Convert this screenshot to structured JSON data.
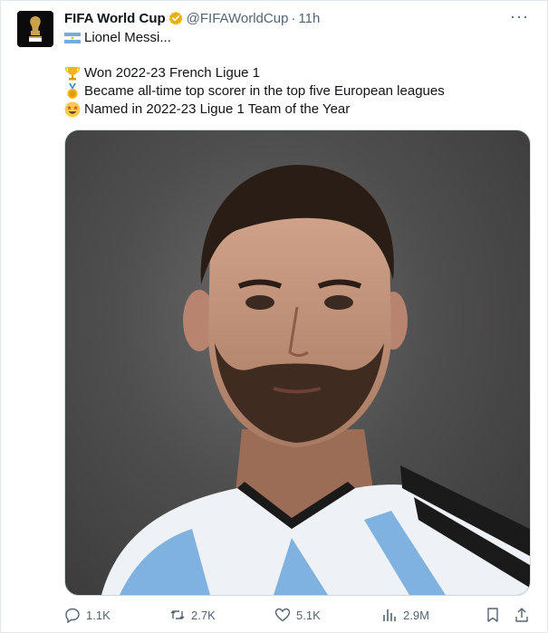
{
  "tweet": {
    "display_name": "FIFA World Cup",
    "handle": "@FIFAWorldCup",
    "separator": "·",
    "time": "11h",
    "more": "···",
    "lines": [
      {
        "text": "Lionel Messi...",
        "icon": "argentina-flag-icon"
      },
      {
        "text": "Won 2022-23 French Ligue 1",
        "icon": "trophy-icon"
      },
      {
        "text": "Became all-time top scorer in the top five European leagues",
        "icon": "medal-icon"
      },
      {
        "text": "Named in 2022-23 Ligue 1 Team of the Year",
        "icon": "star-struck-icon"
      }
    ],
    "media_description_icon": "player-portrait-image"
  },
  "actions": {
    "replies": "1.1K",
    "retweets": "2.7K",
    "likes": "5.1K",
    "views": "2.9M"
  },
  "colors": {
    "text": "#0f1419",
    "secondary": "#536471",
    "verified": "#e8b100",
    "border": "#e1e8ed"
  }
}
